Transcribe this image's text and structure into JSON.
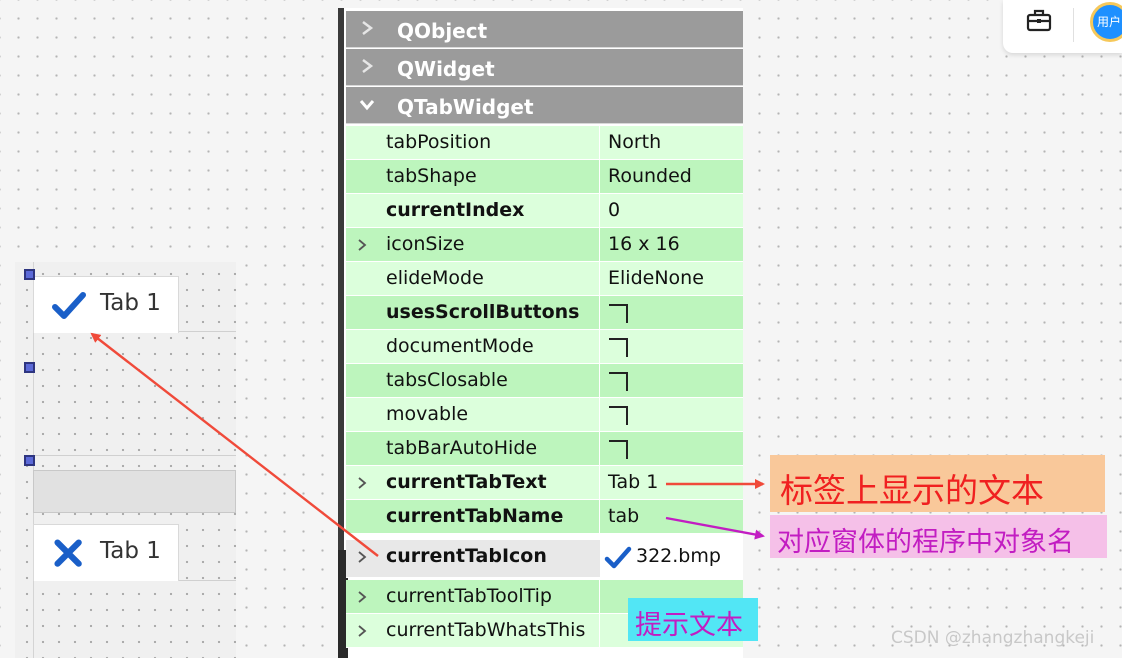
{
  "designer": {
    "tab_top": {
      "label": "Tab 1",
      "icon": "check-icon"
    },
    "tab_bottom": {
      "label": "Tab 1",
      "icon": "x-icon"
    }
  },
  "property_editor": {
    "groups": [
      {
        "label": "QObject",
        "expanded": false
      },
      {
        "label": "QWidget",
        "expanded": false
      },
      {
        "label": "QTabWidget",
        "expanded": true
      }
    ],
    "properties": [
      {
        "name": "tabPosition",
        "value": "North",
        "bold": false,
        "expandable": false
      },
      {
        "name": "tabShape",
        "value": "Rounded",
        "bold": false,
        "expandable": false
      },
      {
        "name": "currentIndex",
        "value": "0",
        "bold": true,
        "expandable": false
      },
      {
        "name": "iconSize",
        "value": "16 x 16",
        "bold": false,
        "expandable": true
      },
      {
        "name": "elideMode",
        "value": "ElideNone",
        "bold": false,
        "expandable": false
      },
      {
        "name": "usesScrollButtons",
        "checked": false,
        "bold": true,
        "expandable": false
      },
      {
        "name": "documentMode",
        "checked": false,
        "bold": false,
        "expandable": false
      },
      {
        "name": "tabsClosable",
        "checked": false,
        "bold": false,
        "expandable": false
      },
      {
        "name": "movable",
        "checked": false,
        "bold": false,
        "expandable": false
      },
      {
        "name": "tabBarAutoHide",
        "checked": false,
        "bold": false,
        "expandable": false
      },
      {
        "name": "currentTabText",
        "value": "Tab 1",
        "bold": true,
        "expandable": true
      },
      {
        "name": "currentTabName",
        "value": "tab",
        "bold": true,
        "expandable": false
      },
      {
        "name": "currentTabIcon",
        "value": "322.bmp",
        "bold": true,
        "expandable": true,
        "icon": "check-icon"
      },
      {
        "name": "currentTabToolTip",
        "value": "",
        "bold": false,
        "expandable": true
      },
      {
        "name": "currentTabWhatsThis",
        "value": "",
        "bold": false,
        "expandable": true
      }
    ]
  },
  "annotations": {
    "tab_text": "标签上显示的文本",
    "object_name": "对应窗体的程序中对象名",
    "tooltip": "提示文本"
  },
  "colors": {
    "row_light": "#dcffdc",
    "row_dark": "#bdf5bd",
    "group_header": "#9b9b9b",
    "arrow_red": "#f04a3a",
    "arrow_magenta": "#c21dc2",
    "check_blue": "#1a5fc8"
  },
  "top_toolbar": {
    "toolbox_icon": "toolbox-icon",
    "avatar_label": "用户"
  },
  "watermark": "CSDN @zhangzhangkeji"
}
